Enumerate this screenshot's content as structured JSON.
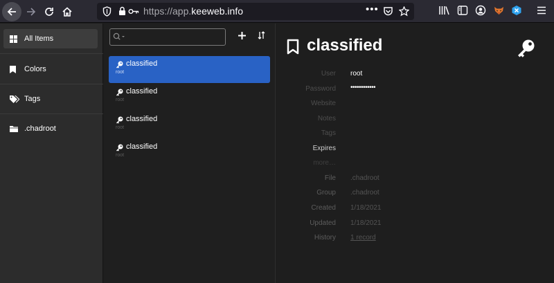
{
  "browser": {
    "url_prefix": "https://app.",
    "url_host": "keeweb.info",
    "page_actions": "•••"
  },
  "menu": {
    "items": [
      {
        "label": "All Items",
        "icon": "grid-icon"
      },
      {
        "label": "Colors",
        "icon": "bookmark-icon"
      },
      {
        "label": "Tags",
        "icon": "tags-icon"
      },
      {
        "label": ".chadroot",
        "icon": "folder-icon"
      }
    ]
  },
  "list": {
    "entries": [
      {
        "title": "classified",
        "user": "root"
      },
      {
        "title": "classified",
        "user": "root"
      },
      {
        "title": "classified",
        "user": "root"
      },
      {
        "title": "classified",
        "user": "root"
      }
    ]
  },
  "details": {
    "title": "classified",
    "fields": {
      "user_label": "User",
      "user_value": "root",
      "password_label": "Password",
      "password_value": "••••••••••••",
      "website_label": "Website",
      "notes_label": "Notes",
      "tags_label": "Tags",
      "expires_label": "Expires",
      "more_label": "more…",
      "file_label": "File",
      "file_value": ".chadroot",
      "group_label": "Group",
      "group_value": ".chadroot",
      "created_label": "Created",
      "created_value": "1/18/2021",
      "updated_label": "Updated",
      "updated_value": "1/18/2021",
      "history_label": "History",
      "history_value": "1 record"
    }
  },
  "colors": {
    "accent": "#2962c5",
    "sidebar_bg": "#2c2c2c",
    "list_bg": "#1f1f1f",
    "details_bg": "#1e1e1e"
  }
}
